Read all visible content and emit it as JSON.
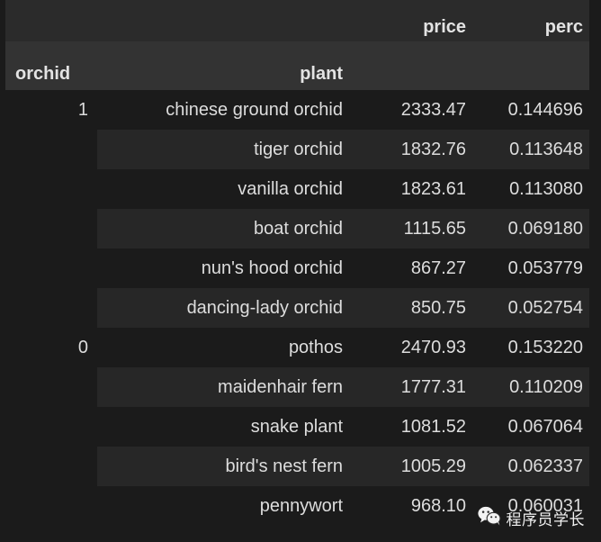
{
  "table": {
    "column_headers": [
      "",
      "",
      "price",
      "perc"
    ],
    "index_names": [
      "orchid",
      "plant"
    ],
    "columns": {
      "price_label": "price",
      "perc_label": "perc"
    },
    "index_label_orchid": "orchid",
    "index_label_plant": "plant",
    "rows": [
      {
        "orchid": "1",
        "plant": "chinese ground orchid",
        "price": "2333.47",
        "perc": "0.144696"
      },
      {
        "orchid": "",
        "plant": "tiger orchid",
        "price": "1832.76",
        "perc": "0.113648"
      },
      {
        "orchid": "",
        "plant": "vanilla orchid",
        "price": "1823.61",
        "perc": "0.113080"
      },
      {
        "orchid": "",
        "plant": "boat orchid",
        "price": "1115.65",
        "perc": "0.069180"
      },
      {
        "orchid": "",
        "plant": "nun's hood orchid",
        "price": "867.27",
        "perc": "0.053779"
      },
      {
        "orchid": "",
        "plant": "dancing-lady orchid",
        "price": "850.75",
        "perc": "0.052754"
      },
      {
        "orchid": "0",
        "plant": "pothos",
        "price": "2470.93",
        "perc": "0.153220"
      },
      {
        "orchid": "",
        "plant": "maidenhair fern",
        "price": "1777.31",
        "perc": "0.110209"
      },
      {
        "orchid": "",
        "plant": "snake plant",
        "price": "1081.52",
        "perc": "0.067064"
      },
      {
        "orchid": "",
        "plant": "bird's nest fern",
        "price": "1005.29",
        "perc": "0.062337"
      },
      {
        "orchid": "",
        "plant": "pennywort",
        "price": "968.10",
        "perc": "0.060031"
      }
    ]
  },
  "watermark": {
    "icon": "wechat-icon",
    "text": "程序员学长"
  },
  "colors": {
    "background": "#1b1b1b",
    "header_band": "#2b2b2b",
    "index_band": "#333333",
    "row_stripe": "#272727",
    "text": "#dddddd",
    "header_text": "#e3e3e3"
  }
}
